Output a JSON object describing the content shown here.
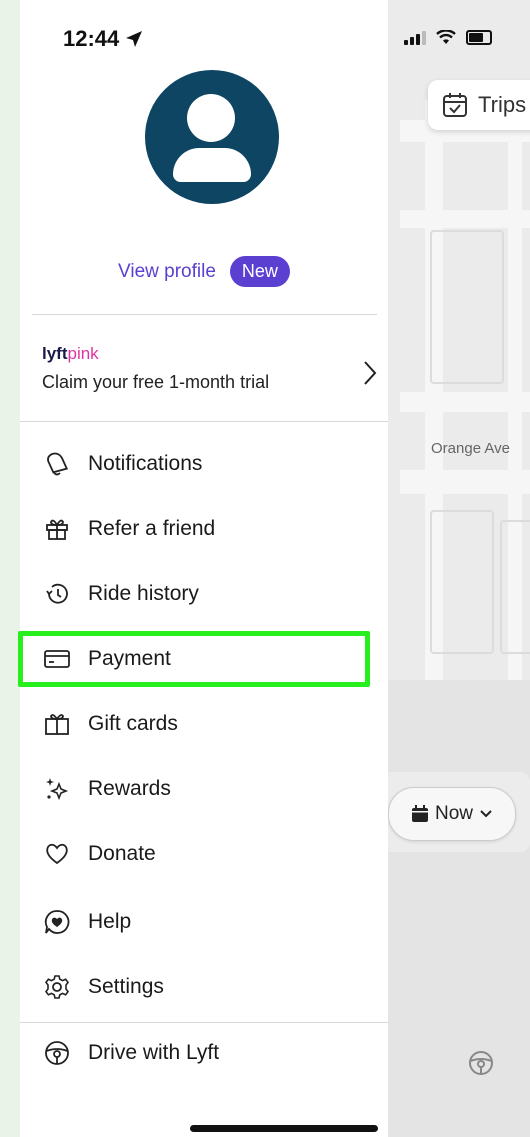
{
  "status_bar": {
    "time": "12:44",
    "location_icon": "location-arrow-icon",
    "signal_icon": "cellular-signal-icon",
    "wifi_icon": "wifi-icon",
    "battery_icon": "battery-icon"
  },
  "map": {
    "trips_label": "Trips",
    "street_label": "Orange Ave",
    "schedule_label": "Now"
  },
  "drawer": {
    "view_profile_label": "View profile",
    "new_badge": "New",
    "lyft_pink": {
      "brand": "lyft",
      "brand_suffix": "pink",
      "promo_text": "Claim your free 1-month trial"
    },
    "menu": [
      {
        "label": "Notifications",
        "icon": "bell-icon"
      },
      {
        "label": "Refer a friend",
        "icon": "gift-icon"
      },
      {
        "label": "Ride history",
        "icon": "history-icon"
      },
      {
        "label": "Payment",
        "icon": "credit-card-icon",
        "highlighted": true
      },
      {
        "label": "Gift cards",
        "icon": "gift-card-icon"
      },
      {
        "label": "Rewards",
        "icon": "sparkle-icon"
      },
      {
        "label": "Donate",
        "icon": "heart-icon"
      },
      {
        "label": "Help",
        "icon": "help-chat-icon"
      },
      {
        "label": "Settings",
        "icon": "gear-icon"
      },
      {
        "label": "Drive with Lyft",
        "icon": "steering-wheel-icon"
      }
    ]
  },
  "colors": {
    "accent": "#5b3fd1",
    "avatar_bg": "#0d4562",
    "highlight": "#27ee1d",
    "pink": "#e0349f"
  }
}
